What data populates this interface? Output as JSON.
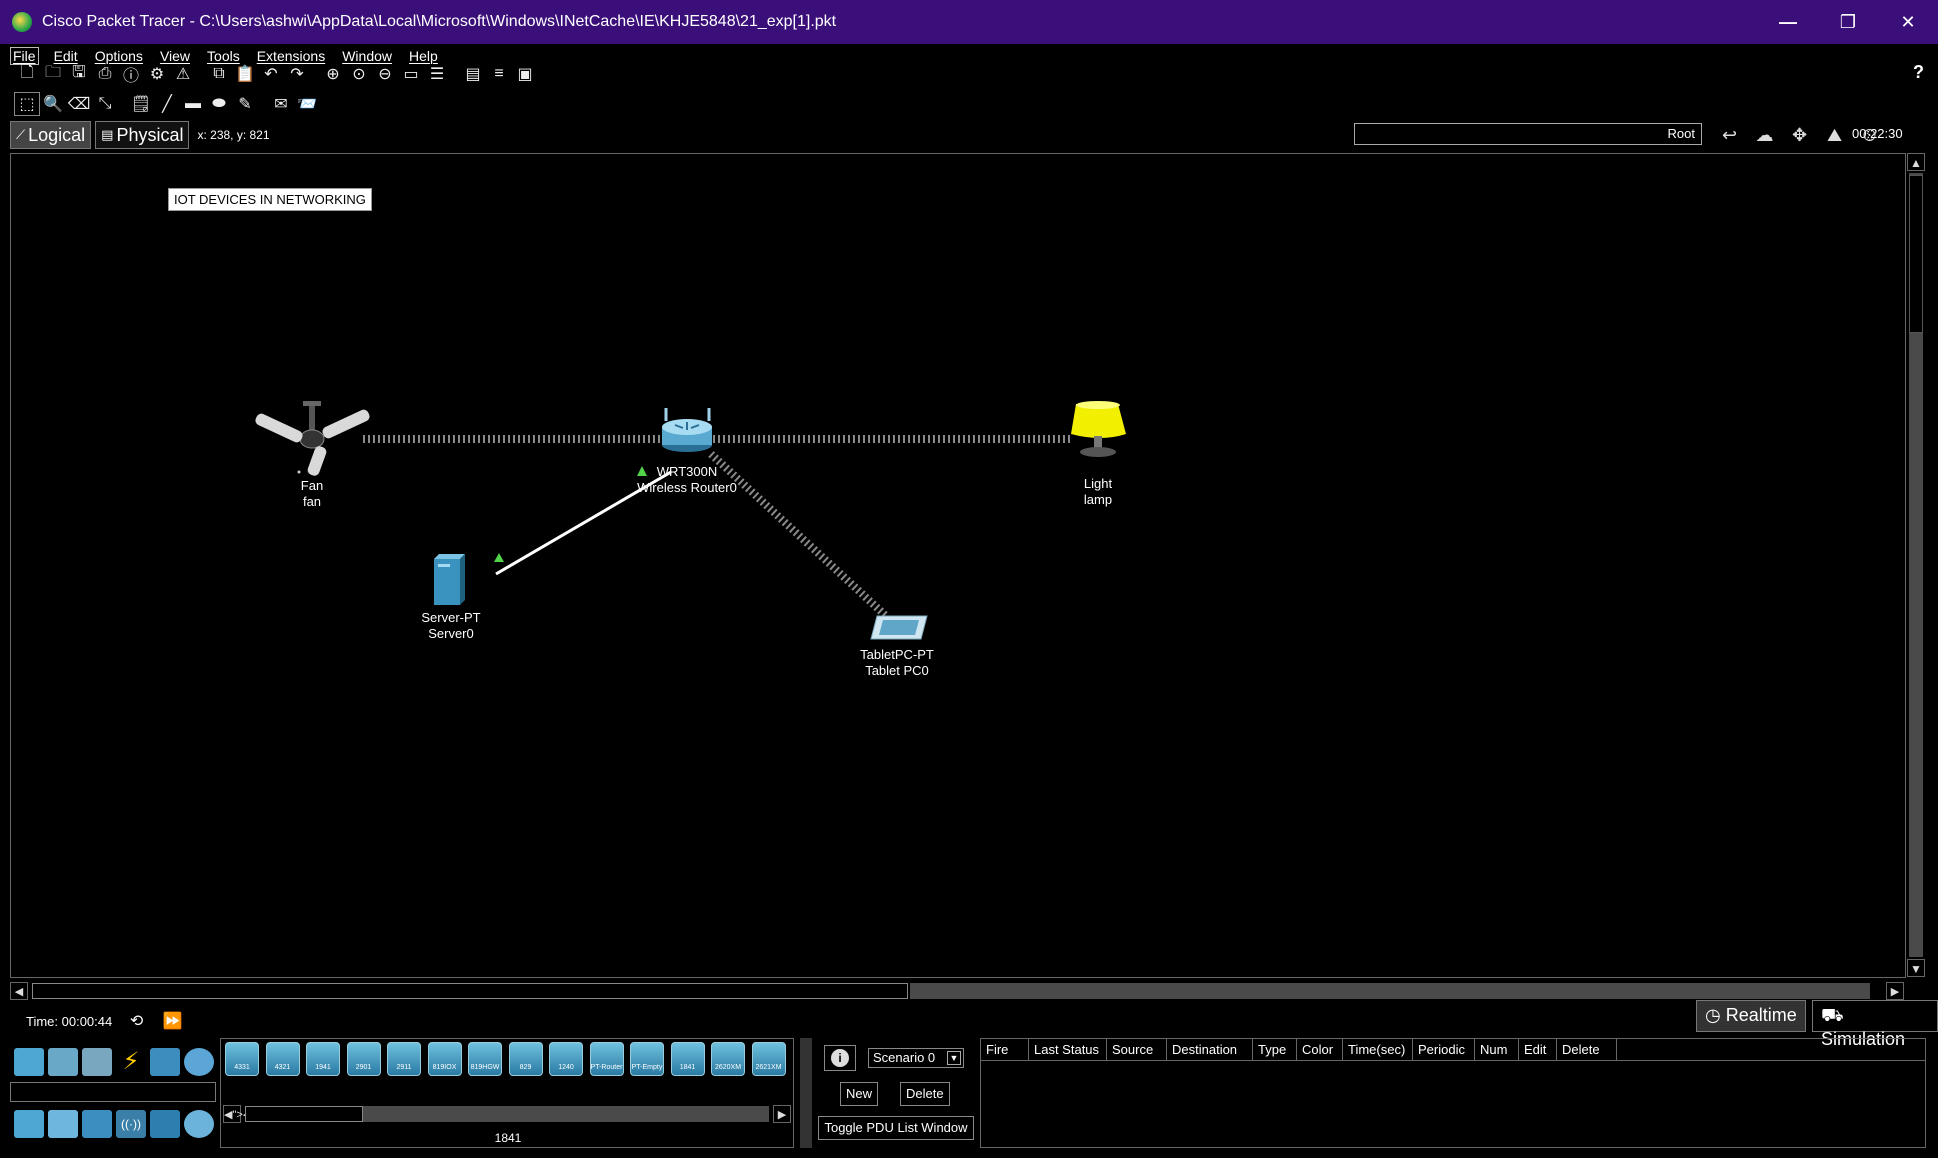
{
  "window": {
    "title": "Cisco Packet Tracer - C:\\Users\\ashwi\\AppData\\Local\\Microsoft\\Windows\\INetCache\\IE\\KHJE5848\\21_exp[1].pkt",
    "minimize": "—",
    "restore": "❐",
    "close": "✕"
  },
  "menu": [
    "File",
    "Edit",
    "Options",
    "View",
    "Tools",
    "Extensions",
    "Window",
    "Help"
  ],
  "toolbar": {
    "help": "?"
  },
  "viewbar": {
    "logical_label": "Logical",
    "physical_label": "Physical",
    "coords": "x: 238, y: 821",
    "root_label": "Root",
    "clock": "00:22:30"
  },
  "workspace": {
    "note": "IOT DEVICES IN NETWORKING",
    "devices": {
      "fan": {
        "model": "Fan",
        "name": "fan"
      },
      "router": {
        "model": "WRT300N",
        "name": "Wireless Router0"
      },
      "lamp": {
        "model": "Light",
        "name": "lamp"
      },
      "server": {
        "model": "Server-PT",
        "name": "Server0"
      },
      "tablet": {
        "model": "TabletPC-PT",
        "name": "Tablet PC0"
      }
    }
  },
  "simulation": {
    "time": "Time: 00:00:44",
    "realtime_label": "Realtime",
    "simulation_label": "Simulation"
  },
  "device_panel": {
    "models": [
      "4331",
      "4321",
      "1941",
      "2901",
      "2911",
      "819IOX",
      "819HGW",
      "829",
      "1240",
      "PT-Router",
      "PT-Empty",
      "1841",
      "2620XM",
      "2621XM"
    ],
    "selected": "1841"
  },
  "scenario": {
    "select_value": "Scenario 0",
    "new_label": "New",
    "delete_label": "Delete",
    "toggle_label": "Toggle PDU List Window"
  },
  "pdu_table": {
    "columns": [
      "Fire",
      "Last Status",
      "Source",
      "Destination",
      "Type",
      "Color",
      "Time(sec)",
      "Periodic",
      "Num",
      "Edit",
      "Delete"
    ]
  },
  "colors": {
    "titlebar": "#3b0f7a",
    "link_wireless": "#8a8a8a",
    "link_wired": "#ffffff",
    "link_status": "#53d34a",
    "lamp": "#f2ef00"
  }
}
